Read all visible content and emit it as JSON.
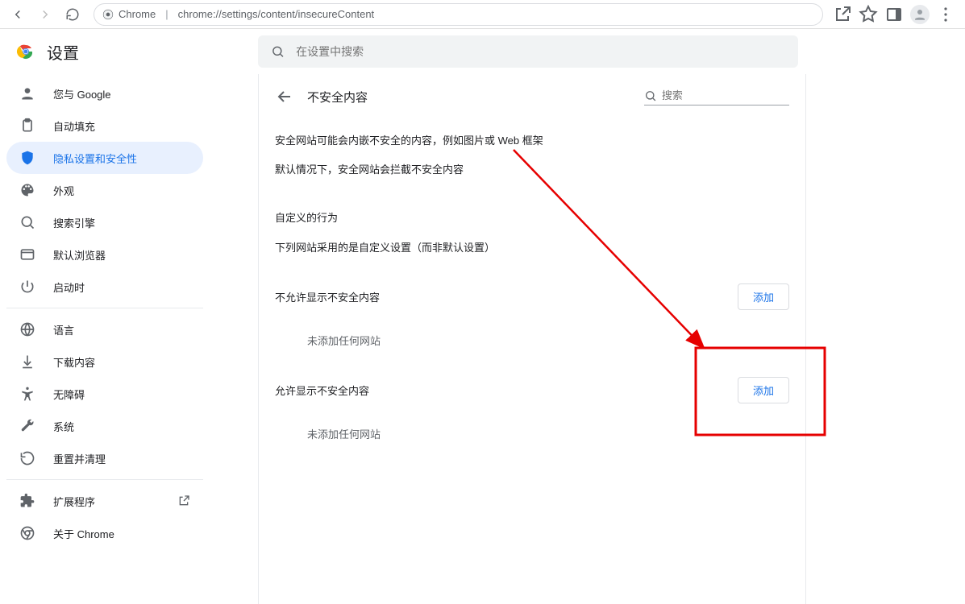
{
  "browser": {
    "address_label_prefix": "Chrome",
    "address_path": "chrome://settings/content/insecureContent"
  },
  "header": {
    "app_title": "设置",
    "search_placeholder": "在设置中搜索"
  },
  "sidebar": {
    "items": [
      {
        "label": "您与 Google"
      },
      {
        "label": "自动填充"
      },
      {
        "label": "隐私设置和安全性"
      },
      {
        "label": "外观"
      },
      {
        "label": "搜索引擎"
      },
      {
        "label": "默认浏览器"
      },
      {
        "label": "启动时"
      }
    ],
    "secondary": [
      {
        "label": "语言"
      },
      {
        "label": "下载内容"
      },
      {
        "label": "无障碍"
      },
      {
        "label": "系统"
      },
      {
        "label": "重置并清理"
      }
    ],
    "tertiary": [
      {
        "label": "扩展程序"
      },
      {
        "label": "关于 Chrome"
      }
    ]
  },
  "panel": {
    "title": "不安全内容",
    "search_placeholder": "搜索",
    "desc1": "安全网站可能会内嵌不安全的内容，例如图片或 Web 框架",
    "desc2": "默认情况下，安全网站会拦截不安全内容",
    "custom_behavior_heading": "自定义的行为",
    "custom_behavior_desc": "下列网站采用的是自定义设置（而非默认设置）",
    "block": {
      "label": "不允许显示不安全内容",
      "add_button": "添加",
      "empty": "未添加任何网站"
    },
    "allow": {
      "label": "允许显示不安全内容",
      "add_button": "添加",
      "empty": "未添加任何网站"
    }
  }
}
